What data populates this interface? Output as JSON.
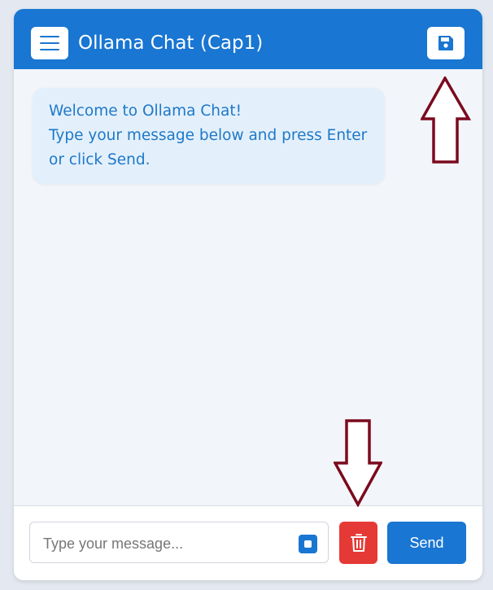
{
  "header": {
    "title": "Ollama Chat (Cap1)",
    "menu_icon": "hamburger-menu-icon",
    "save_icon": "floppy-disk-save-icon"
  },
  "messages": [
    {
      "role": "system",
      "lines": [
        "Welcome to Ollama Chat!",
        "Type your message below and press Enter",
        "or click Send."
      ]
    }
  ],
  "composer": {
    "placeholder": "Type your message...",
    "value": "",
    "stop_icon": "stop-square-icon",
    "clear_icon": "trash-icon",
    "send_label": "Send"
  },
  "annotations": [
    {
      "icon": "up-arrow-icon",
      "points_to": "save-button"
    },
    {
      "icon": "down-arrow-icon",
      "points_to": "clear-chat-button"
    }
  ],
  "colors": {
    "primary": "#1976d2",
    "danger": "#e53935",
    "bubble_bg": "#e3f0fb",
    "bubble_text": "#1f78c8",
    "chat_bg": "#f2f5f9",
    "annotation_arrow": "#7b0a1e"
  }
}
